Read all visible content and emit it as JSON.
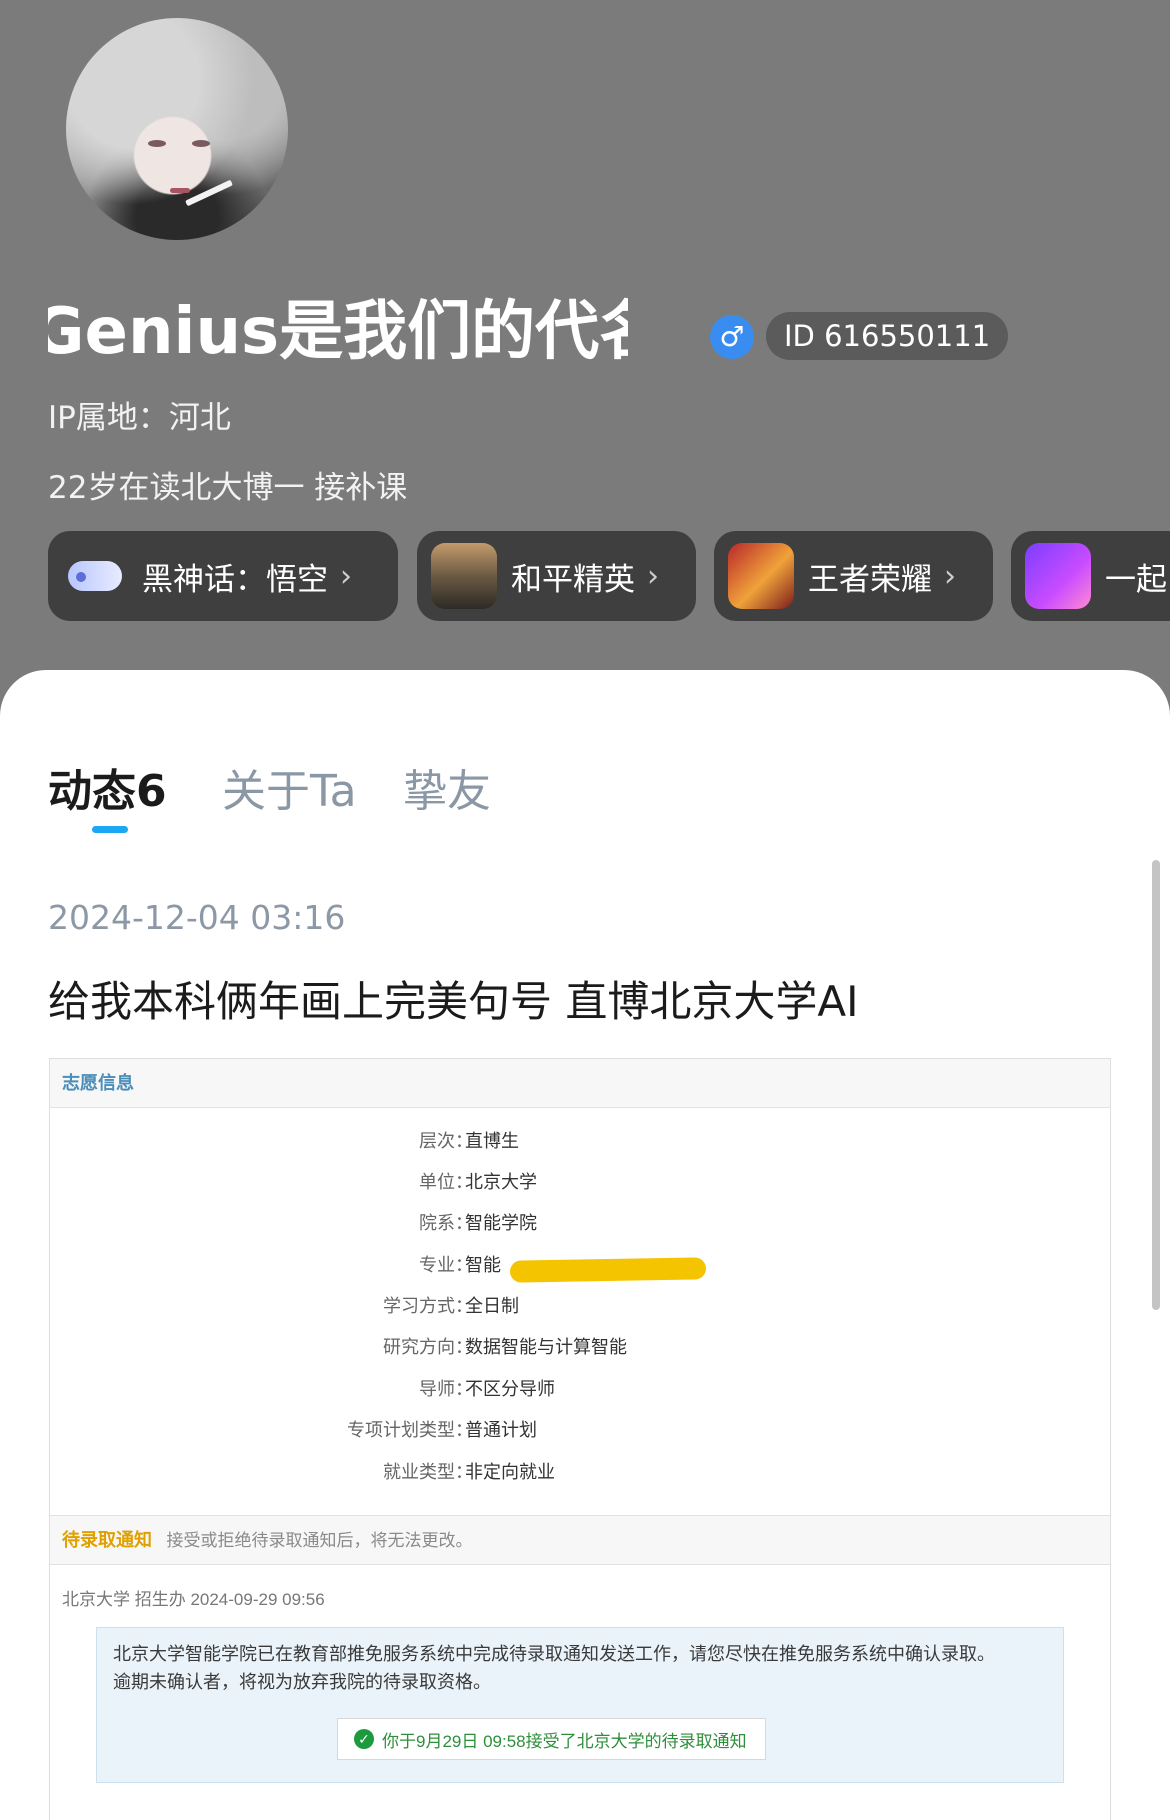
{
  "profile": {
    "username": "Genius是我们的代名词",
    "gender_symbol": "♂",
    "id_label": "ID 616550111",
    "ip_location": "IP属地：河北",
    "bio": "22岁在读北大博一   接补课"
  },
  "game_chips": [
    {
      "label": "黑神话：悟空",
      "icon": "gamepad-icon"
    },
    {
      "label": "和平精英",
      "icon": "peace-elite-game-icon"
    },
    {
      "label": "王者荣耀",
      "icon": "honor-of-kings-game-icon"
    },
    {
      "label": "一起",
      "icon": "party-game-icon"
    }
  ],
  "tabs": [
    {
      "label": "动态6",
      "active": true
    },
    {
      "label": "关于Ta",
      "active": false
    },
    {
      "label": "挚友",
      "active": false
    }
  ],
  "post": {
    "time": "2024-12-04 03:16",
    "text": "给我本科俩年画上完美句号   直博北京大学AI",
    "screenshot": {
      "header": "志愿信息",
      "fields": [
        {
          "key": "层次：",
          "value": "直博生"
        },
        {
          "key": "单位：",
          "value": "北京大学"
        },
        {
          "key": "院系：",
          "value": "智能学院"
        },
        {
          "key": "专业：",
          "value": "智能"
        },
        {
          "key": "学习方式：",
          "value": "全日制"
        },
        {
          "key": "研究方向：",
          "value": "数据智能与计算智能"
        },
        {
          "key": "导师：",
          "value": "不区分导师"
        },
        {
          "key": "专项计划类型：",
          "value": "普通计划"
        },
        {
          "key": "就业类型：",
          "value": "非定向就业"
        }
      ],
      "notice_title": "待录取通知",
      "notice_subtitle": "接受或拒绝待录取通知后，将无法更改。",
      "sender_line": "北京大学 招生办 2024-09-29 09:56",
      "message_line1": "北京大学智能学院已在教育部推免服务系统中完成待录取通知发送工作，请您尽快在推免服务系统中确认录取。",
      "message_line2": "逾期未确认者，将视为放弃我院的待录取资格。",
      "accepted_text": "你于9月29日 09:58接受了北京大学的待录取通知"
    }
  },
  "colors": {
    "header_bg": "#7b7b7b",
    "chip_bg": "#3f3f3f",
    "tab_accent": "#1aa7f3",
    "inactive_tab": "#8a97a5",
    "notice_orange": "#e0a000",
    "accepted_green": "#2e8f3b",
    "redaction_yellow": "#f5c400"
  }
}
